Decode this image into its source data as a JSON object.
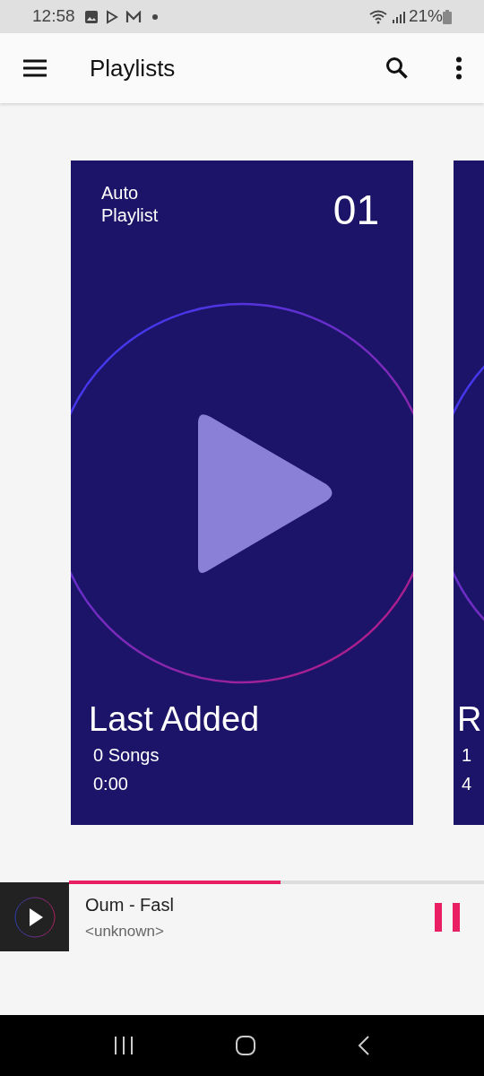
{
  "status_bar": {
    "time": "12:58",
    "battery": "21%"
  },
  "app_bar": {
    "title": "Playlists"
  },
  "playlists": [
    {
      "type": "Auto\nPlaylist",
      "number": "01",
      "name": "Last Added",
      "songs": "0 Songs",
      "duration": "0:00"
    },
    {
      "name": "R",
      "songs": "1",
      "duration": "4"
    }
  ],
  "now_playing": {
    "title": "Oum - Fasl",
    "artist": "<unknown>",
    "playing": true,
    "level": 0.51
  }
}
